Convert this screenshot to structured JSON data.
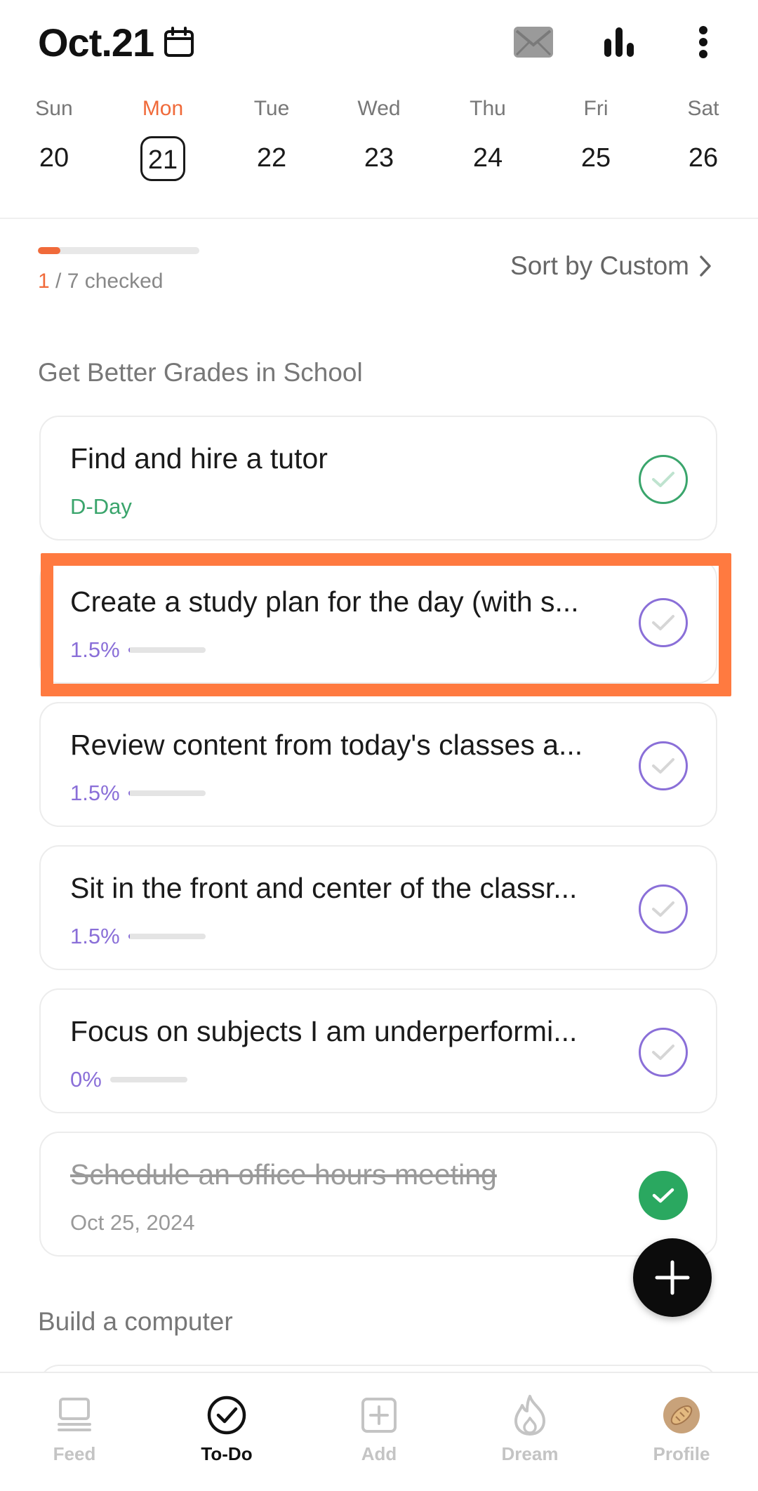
{
  "header": {
    "date_title": "Oct.21",
    "icons": [
      "calendar-icon",
      "mail-icon",
      "bar-chart-icon",
      "more-vertical-icon"
    ]
  },
  "week": [
    {
      "name": "Sun",
      "num": "20",
      "selected": false
    },
    {
      "name": "Mon",
      "num": "21",
      "selected": true
    },
    {
      "name": "Tue",
      "num": "22",
      "selected": false
    },
    {
      "name": "Wed",
      "num": "23",
      "selected": false
    },
    {
      "name": "Thu",
      "num": "24",
      "selected": false
    },
    {
      "name": "Fri",
      "num": "25",
      "selected": false
    },
    {
      "name": "Sat",
      "num": "26",
      "selected": false
    }
  ],
  "summary": {
    "checked": "1",
    "total_text": " / 7 checked",
    "progress": 0.14,
    "sort_label": "Sort by Custom"
  },
  "sections": [
    {
      "title": "Get Better Grades in School",
      "tasks": [
        {
          "title": "Find and hire a tutor",
          "sub": "D-Day",
          "sub_type": "dday",
          "status": "pending-green"
        },
        {
          "title": "Create a study plan for the day (with s...",
          "sub": "1.5%",
          "sub_type": "pct",
          "progress": 0.015,
          "status": "pending-purple"
        },
        {
          "title": "Review content from today's classes a...",
          "sub": "1.5%",
          "sub_type": "pct",
          "progress": 0.015,
          "status": "pending-purple"
        },
        {
          "title": "Sit in the front and center of the classr...",
          "sub": "1.5%",
          "sub_type": "pct",
          "progress": 0.015,
          "status": "pending-purple"
        },
        {
          "title": "Focus on subjects I am underperformi...",
          "sub": "0%",
          "sub_type": "pct",
          "progress": 0.0,
          "status": "pending-purple"
        },
        {
          "title": "Schedule an office hours meeting",
          "sub": "Oct 25, 2024",
          "sub_type": "date",
          "status": "done"
        }
      ]
    },
    {
      "title": "Build a computer",
      "tasks": []
    }
  ],
  "nav": [
    {
      "label": "Feed",
      "icon": "feed-icon",
      "active": false
    },
    {
      "label": "To-Do",
      "icon": "todo-check-icon",
      "active": true
    },
    {
      "label": "Add",
      "icon": "add-square-icon",
      "active": false
    },
    {
      "label": "Dream",
      "icon": "flame-icon",
      "active": false
    },
    {
      "label": "Profile",
      "icon": "profile-avatar-icon",
      "active": false
    }
  ],
  "colors": {
    "accent": "#f06a3a",
    "green": "#3aa56c",
    "purple": "#8a6fd8",
    "highlight": "#ff7a40"
  }
}
